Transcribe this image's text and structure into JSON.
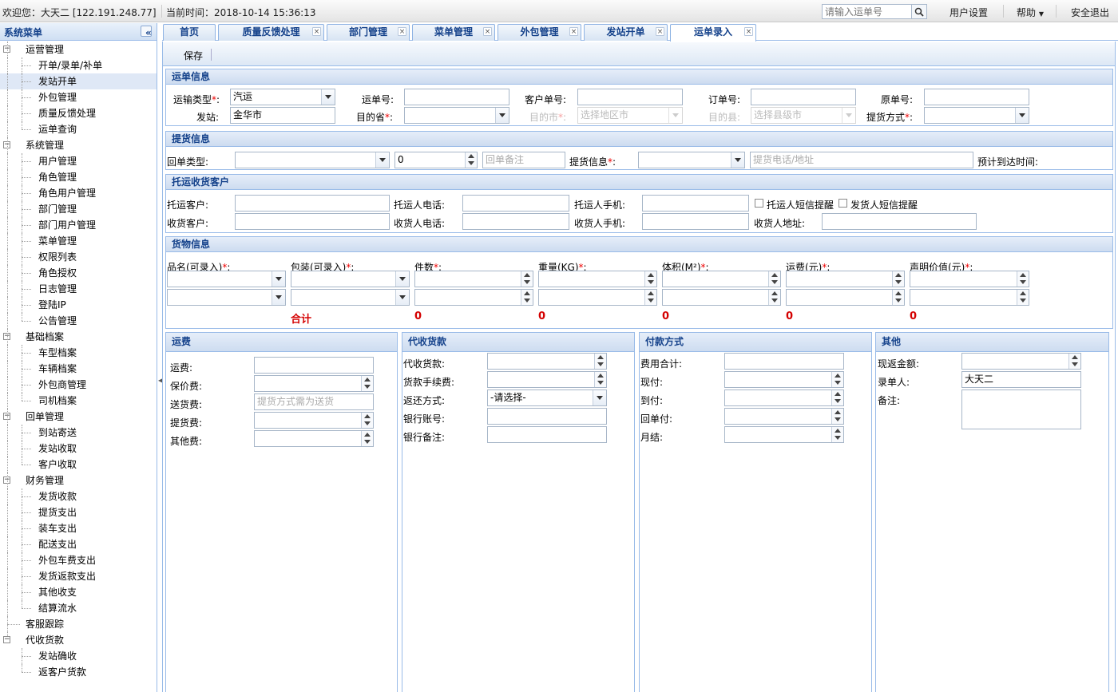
{
  "topbar": {
    "welcome": "欢迎您：大天二 [122.191.248.77]",
    "time": "当前时间：2018-10-14 15:36:13",
    "search_placeholder": "请输入运单号",
    "user_settings": "用户设置",
    "help": "帮助",
    "logout": "安全退出"
  },
  "sidebar": {
    "title": "系统菜单",
    "collapse_icon": "double-chevron-left-icon",
    "tree": [
      {
        "label": "运营管理",
        "level": 0
      },
      {
        "label": "开单/录单/补单",
        "level": 1
      },
      {
        "label": "发站开单",
        "level": 1,
        "selected": true
      },
      {
        "label": "外包管理",
        "level": 1
      },
      {
        "label": "质量反馈处理",
        "level": 1
      },
      {
        "label": "运单查询",
        "level": 1
      },
      {
        "label": "系统管理",
        "level": 0
      },
      {
        "label": "用户管理",
        "level": 1
      },
      {
        "label": "角色管理",
        "level": 1
      },
      {
        "label": "角色用户管理",
        "level": 1
      },
      {
        "label": "部门管理",
        "level": 1
      },
      {
        "label": "部门用户管理",
        "level": 1
      },
      {
        "label": "菜单管理",
        "level": 1
      },
      {
        "label": "权限列表",
        "level": 1
      },
      {
        "label": "角色授权",
        "level": 1
      },
      {
        "label": "日志管理",
        "level": 1
      },
      {
        "label": "登陆IP",
        "level": 1
      },
      {
        "label": "公告管理",
        "level": 1
      },
      {
        "label": "基础档案",
        "level": 0
      },
      {
        "label": "车型档案",
        "level": 1
      },
      {
        "label": "车辆档案",
        "level": 1
      },
      {
        "label": "外包商管理",
        "level": 1
      },
      {
        "label": "司机档案",
        "level": 1
      },
      {
        "label": "回单管理",
        "level": 0
      },
      {
        "label": "到站寄送",
        "level": 1
      },
      {
        "label": "发站收取",
        "level": 1
      },
      {
        "label": "客户收取",
        "level": 1
      },
      {
        "label": "财务管理",
        "level": 0
      },
      {
        "label": "发货收款",
        "level": 1
      },
      {
        "label": "提货支出",
        "level": 1
      },
      {
        "label": "装车支出",
        "level": 1
      },
      {
        "label": "配送支出",
        "level": 1
      },
      {
        "label": "外包车费支出",
        "level": 1
      },
      {
        "label": "发货返款支出",
        "level": 1
      },
      {
        "label": "其他收支",
        "level": 1
      },
      {
        "label": "结算流水",
        "level": 1
      },
      {
        "label": "客服跟踪",
        "level": 0,
        "leaf": true
      },
      {
        "label": "代收货款",
        "level": 0
      },
      {
        "label": "发站确收",
        "level": 1
      },
      {
        "label": "返客户货款",
        "level": 1
      }
    ]
  },
  "tabs": [
    {
      "label": "首页",
      "closable": false
    },
    {
      "label": "质量反馈处理",
      "closable": true
    },
    {
      "label": "部门管理",
      "closable": true
    },
    {
      "label": "菜单管理",
      "closable": true
    },
    {
      "label": "外包管理",
      "closable": true
    },
    {
      "label": "发站开单",
      "closable": true
    },
    {
      "label": "运单录入",
      "closable": true,
      "active": true
    }
  ],
  "toolbar": {
    "save": "保存"
  },
  "waybill": {
    "title": "运单信息",
    "transport_type_label": "运输类型",
    "transport_type_value": "汽运",
    "waybill_no_label": "运单号:",
    "customer_no_label": "客户单号:",
    "order_no_label": "订单号:",
    "original_no_label": "原单号:",
    "origin_label": "发站:",
    "origin_value": "金华市",
    "dest_province_label": "目的省",
    "dest_city_label": "目的市",
    "dest_city_placeholder": "选择地区市",
    "dest_county_label": "目的县:",
    "dest_county_placeholder": "选择县级市",
    "pickup_mode_label": "提货方式"
  },
  "pickup": {
    "title": "提货信息",
    "return_type_label": "回单类型:",
    "return_count": "0",
    "return_note_placeholder": "回单备注",
    "pickup_info_label": "提货信息",
    "pickup_contact_placeholder": "提货电话/地址",
    "eta_label": "预计到达时间:"
  },
  "customer": {
    "title": "托运收货客户",
    "shipper_label": "托运客户:",
    "shipper_phone_label": "托运人电话:",
    "shipper_mobile_label": "托运人手机:",
    "shipper_sms_label": "托运人短信提醒",
    "sender_sms_label": "发货人短信提醒",
    "consignee_label": "收货客户:",
    "consignee_phone_label": "收货人电话:",
    "consignee_mobile_label": "收货人手机:",
    "consignee_addr_label": "收货人地址:"
  },
  "goods": {
    "title": "货物信息",
    "columns": [
      "品名(可录入)",
      "包装(可录入)",
      "件数",
      "重量(KG)",
      "体积(M²)",
      "运费(元)",
      "声明价值(元)"
    ],
    "total_label": "合计",
    "totals": [
      "0",
      "0",
      "0",
      "0",
      "0"
    ]
  },
  "freight": {
    "title": "运费",
    "fields": [
      "运费:",
      "保价费:",
      "送货费:",
      "提货费:",
      "其他费:"
    ],
    "delivery_placeholder": "提货方式需为送货"
  },
  "cod": {
    "title": "代收货款",
    "fields": [
      "代收货款:",
      "货款手续费:",
      "返还方式:",
      "银行账号:",
      "银行备注:"
    ],
    "return_mode_value": "-请选择-"
  },
  "payment": {
    "title": "付款方式",
    "fields": [
      "费用合计:",
      "现付:",
      "到付:",
      "回单付:",
      "月结:"
    ]
  },
  "other": {
    "title": "其他",
    "fields": [
      "现返金额:",
      "录单人:",
      "备注:"
    ],
    "creator_value": "大天二"
  }
}
